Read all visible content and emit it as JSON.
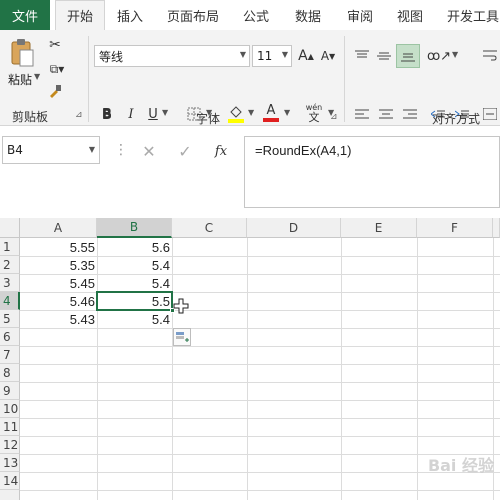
{
  "tabs": [
    "文件",
    "开始",
    "插入",
    "页面布局",
    "公式",
    "数据",
    "审阅",
    "视图",
    "开发工具"
  ],
  "ribbon": {
    "paste_label": "粘贴",
    "clipboard_label": "剪贴板",
    "font_label": "字体",
    "align_label": "对齐方式",
    "font_name": "等线",
    "font_size": "11",
    "grow_font": "A",
    "shrink_font": "A",
    "bold": "B",
    "italic": "I",
    "underline": "U",
    "font_color_letter": "A",
    "wen": "wén",
    "wen_char": "文",
    "launcher": "⊿"
  },
  "namebox": {
    "value": "B4"
  },
  "formula": {
    "value": "=RoundEx(A4,1)",
    "fx": "fx"
  },
  "grid": {
    "columns": [
      "A",
      "B",
      "C",
      "D",
      "E",
      "F"
    ],
    "rows": [
      "1",
      "2",
      "3",
      "4",
      "5",
      "6",
      "7",
      "8",
      "9",
      "10",
      "11",
      "12",
      "13",
      "14"
    ],
    "cells": [
      [
        "5.55",
        "5.6"
      ],
      [
        "5.35",
        "5.4"
      ],
      [
        "5.45",
        "5.4"
      ],
      [
        "5.46",
        "5.5"
      ],
      [
        "5.43",
        "5.4"
      ]
    ],
    "selected": "B4"
  },
  "watermark": "Bai 经验",
  "colors": {
    "accent": "#217346",
    "ribbon_bg": "#f3f3f3",
    "gridline": "#dcdcdc"
  }
}
